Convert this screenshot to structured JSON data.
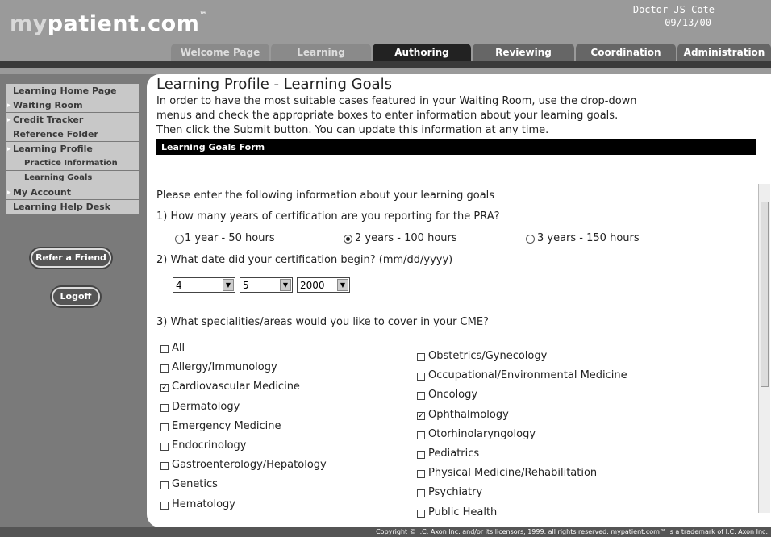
{
  "brand": {
    "prefix": "my",
    "name": "patient.com",
    "tm": "™"
  },
  "user": {
    "name": "Doctor JS Cote",
    "date": "09/13/00"
  },
  "tabs": [
    "Welcome Page",
    "Learning",
    "Authoring",
    "Reviewing",
    "Coordination",
    "Administration"
  ],
  "sidebar": {
    "items": [
      "Learning Home Page",
      "Waiting Room",
      "Credit Tracker",
      "Reference Folder",
      "Learning Profile",
      "Practice Information",
      "Learning Goals",
      "My Account",
      "Learning Help Desk"
    ],
    "refer": "Refer a Friend",
    "logoff": "Logoff"
  },
  "main": {
    "title": "Learning Profile - Learning Goals",
    "intro": [
      "In order to have the most suitable cases featured in your Waiting Room, use the drop-down",
      "menus and check the appropriate boxes to enter information about your learning goals.",
      "Then click the Submit button. You can update this information at any time."
    ],
    "form_title": "Learning Goals Form",
    "prompt": "Please enter the following information about your learning goals",
    "q1": "1) How many years of certification are you reporting for the PRA?",
    "q1_options": [
      {
        "label": "1 year - 50 hours",
        "selected": false
      },
      {
        "label": "2 years - 100 hours",
        "selected": true
      },
      {
        "label": "3 years - 150 hours",
        "selected": false
      }
    ],
    "q2": "2) What date did your certification begin? (mm/dd/yyyy)",
    "q2_values": {
      "month": "4",
      "day": "5",
      "year": "2000"
    },
    "q3": "3) What specialities/areas would you like to cover in your CME?",
    "left_specialties": [
      {
        "label": "All",
        "checked": false
      },
      {
        "label": "Allergy/Immunology",
        "checked": false
      },
      {
        "label": "Cardiovascular Medicine",
        "checked": true
      },
      {
        "label": "Dermatology",
        "checked": false
      },
      {
        "label": "Emergency Medicine",
        "checked": false
      },
      {
        "label": "Endocrinology",
        "checked": false
      },
      {
        "label": "Gastroenterology/Hepatology",
        "checked": false
      },
      {
        "label": "Genetics",
        "checked": false
      },
      {
        "label": "Hematology",
        "checked": false
      }
    ],
    "right_specialties": [
      {
        "label": "Obstetrics/Gynecology",
        "checked": false
      },
      {
        "label": "Occupational/Environmental Medicine",
        "checked": false
      },
      {
        "label": "Oncology",
        "checked": false
      },
      {
        "label": "Ophthalmology",
        "checked": true
      },
      {
        "label": "Otorhinolaryngology",
        "checked": false
      },
      {
        "label": "Pediatrics",
        "checked": false
      },
      {
        "label": "Physical Medicine/Rehabilitation",
        "checked": false
      },
      {
        "label": "Psychiatry",
        "checked": false
      },
      {
        "label": "Public Health",
        "checked": false
      }
    ]
  },
  "footer": "Copyright © I.C. Axon Inc. and/or its licensors, 1999. all rights reserved. mypatient.com™ is a trademark of I.C. Axon Inc."
}
